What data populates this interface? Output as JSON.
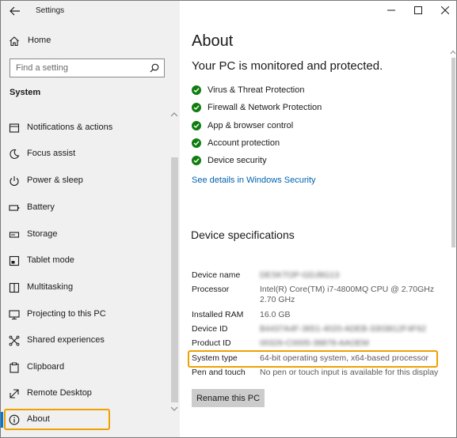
{
  "app": {
    "title": "Settings"
  },
  "sidebar": {
    "home_label": "Home",
    "search_placeholder": "Find a setting",
    "section_label": "System",
    "items": [
      {
        "label": "Notifications & actions",
        "icon": "notifications-icon"
      },
      {
        "label": "Focus assist",
        "icon": "moon-icon"
      },
      {
        "label": "Power & sleep",
        "icon": "power-icon"
      },
      {
        "label": "Battery",
        "icon": "battery-icon"
      },
      {
        "label": "Storage",
        "icon": "storage-icon"
      },
      {
        "label": "Tablet mode",
        "icon": "tablet-mode-icon"
      },
      {
        "label": "Multitasking",
        "icon": "multitasking-icon"
      },
      {
        "label": "Projecting to this PC",
        "icon": "projecting-icon"
      },
      {
        "label": "Shared experiences",
        "icon": "shared-experiences-icon"
      },
      {
        "label": "Clipboard",
        "icon": "clipboard-icon"
      },
      {
        "label": "Remote Desktop",
        "icon": "remote-desktop-icon"
      },
      {
        "label": "About",
        "icon": "info-icon",
        "selected": true
      }
    ]
  },
  "main": {
    "title": "About",
    "status_heading": "Your PC is monitored and protected.",
    "protections": [
      "Virus & Threat Protection",
      "Firewall & Network Protection",
      "App & browser control",
      "Account protection",
      "Device security"
    ],
    "details_link": "See details in Windows Security",
    "specs_heading": "Device specifications",
    "specs": [
      {
        "key": "Device name",
        "value": "DESKTOP-GDJ8G13",
        "obscured": true
      },
      {
        "key": "Processor",
        "value": "Intel(R) Core(TM) i7-4800MQ CPU @ 2.70GHz 2.70 GHz",
        "obscured": false
      },
      {
        "key": "Installed RAM",
        "value": "16.0 GB",
        "obscured": false
      },
      {
        "key": "Device ID",
        "value": "B4437A4F-3651-4020-ADEB-3303812F4F62",
        "obscured": true
      },
      {
        "key": "Product ID",
        "value": "00326-C0005-38878-AAOEM",
        "obscured": true
      },
      {
        "key": "System type",
        "value": "64-bit operating system, x64-based processor",
        "obscured": false,
        "highlighted": true
      },
      {
        "key": "Pen and touch",
        "value": "No pen or touch input is available for this display",
        "obscured": false
      }
    ],
    "rename_button": "Rename this PC"
  },
  "colors": {
    "accent": "#0078d7",
    "highlight_box": "#f0a000",
    "check_green": "#107c10",
    "link": "#0063b1"
  }
}
